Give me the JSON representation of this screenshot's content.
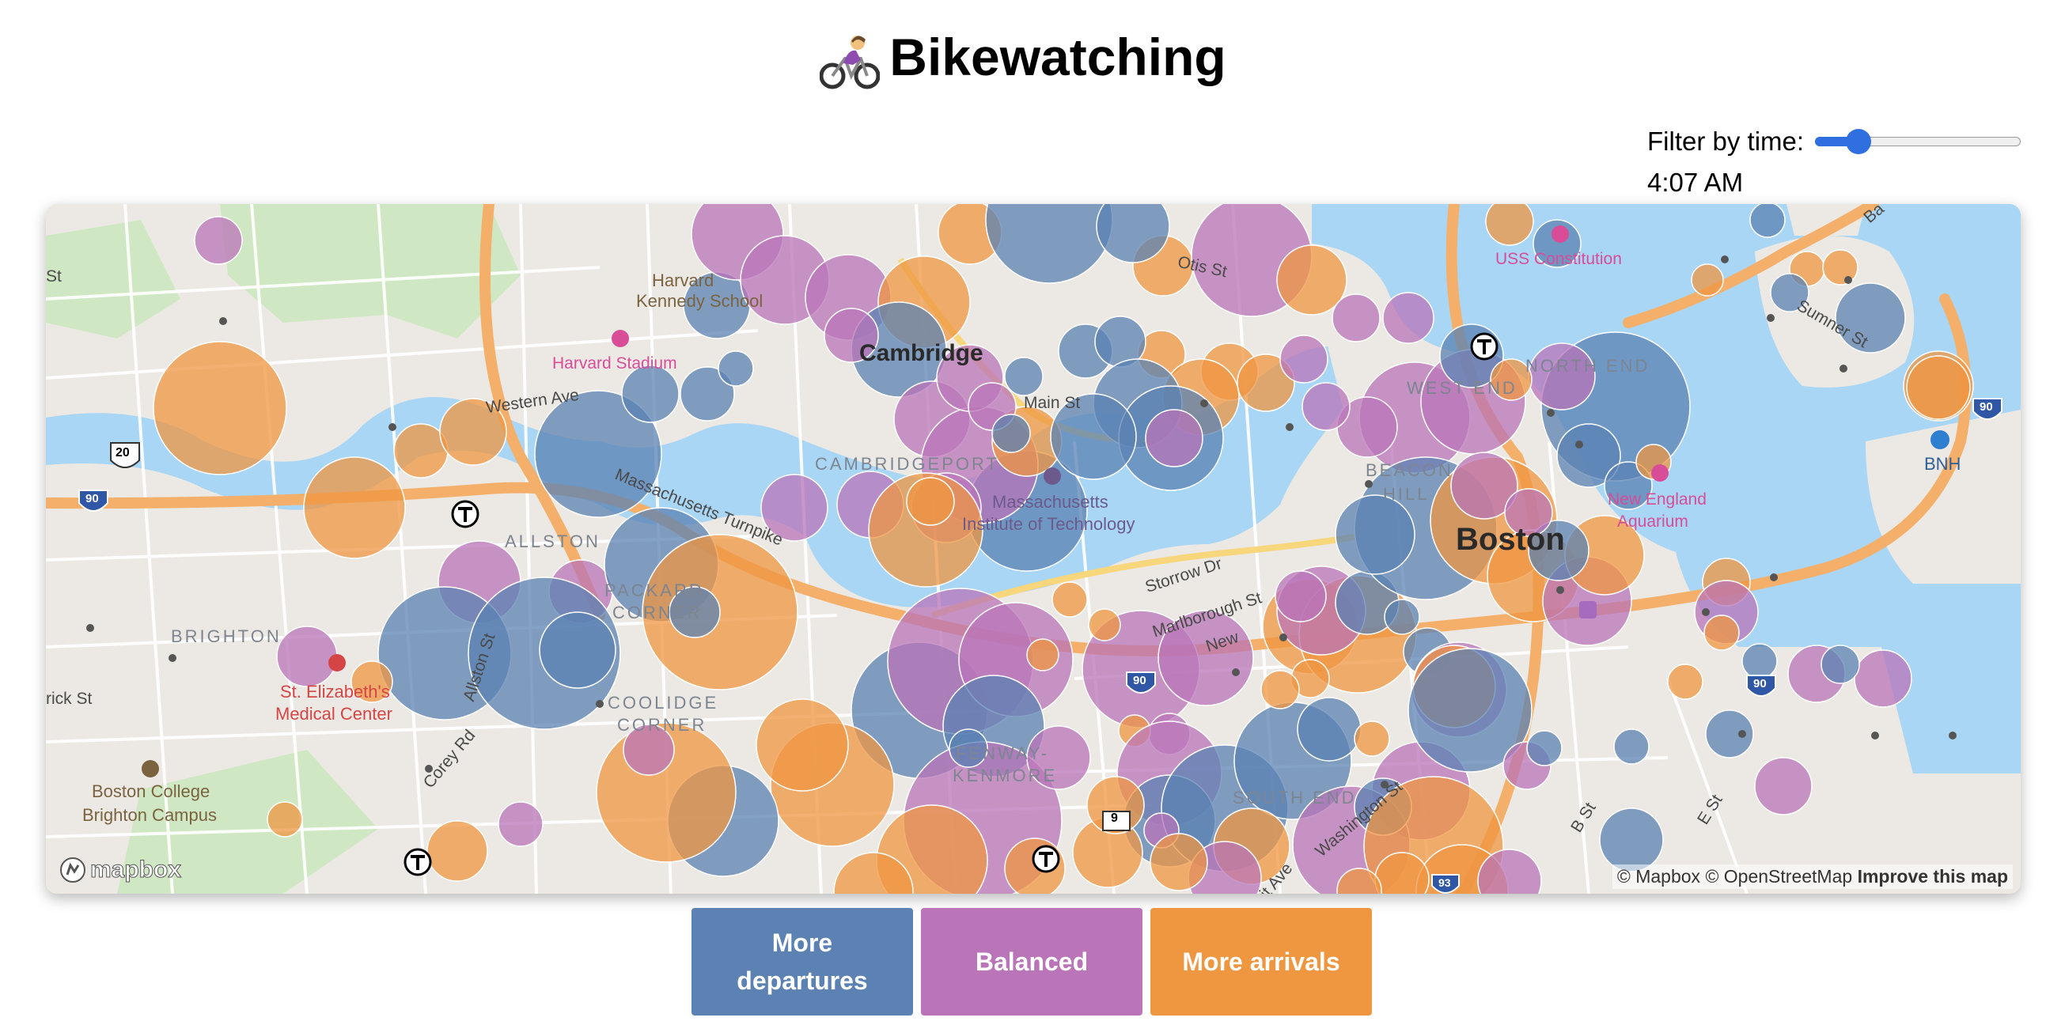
{
  "page": {
    "title": "Bikewatching",
    "title_icon": "woman-biking-icon"
  },
  "filter": {
    "label": "Filter by time:",
    "slider_value_fraction": 0.21,
    "time_display": "4:07 AM"
  },
  "map": {
    "labels": {
      "cambridge": "Cambridge",
      "boston": "Boston",
      "allston": "ALLSTON",
      "brighton": "BRIGHTON",
      "cambridgeport": "CAMBRIDGEPORT",
      "fenway": "FENWAY-",
      "kenmore": "KENMORE",
      "north_end": "NORTH END",
      "west_end": "WEST END",
      "beacon": "BEACON",
      "hill": "HILL",
      "packard": "PACKARD",
      "corner": "CORNER",
      "coolidge": "COOLIDGE",
      "coolidge_corner": "CORNER",
      "south_end": "SOUTH END",
      "western_ave": "Western Ave",
      "mass_pike": "Massachusetts Turnpike",
      "main_st": "Main St",
      "storrow": "Storrow Dr",
      "marlborough": "Marlborough St",
      "allston_st": "Allston St",
      "corey_rd": "Corey Rd",
      "otis_st": "Otis St",
      "sumner_st": "Sumner St",
      "b_st": "B St",
      "e_st": "E St",
      "washington_st": "Washington St",
      "new": "New",
      "st_left": "St",
      "rick_st": "rick St",
      "ave": "it Ave",
      "harvard": "Harvard",
      "kennedy": "Kennedy School",
      "harvard_stadium": "Harvard Stadium",
      "mit1": "Massachusetts",
      "mit2": "Institute of Technology",
      "st_elizabeth1": "St. Elizabeth's",
      "st_elizabeth2": "Medical Center",
      "bc1": "Boston College",
      "bc2": "Brighton Campus",
      "uss": "USS Constitution",
      "ne_aquarium1": "New England",
      "ne_aquarium2": "Aquarium",
      "bnh": "BNH",
      "hwy20": "20",
      "hwy90a": "90",
      "hwy90b": "90",
      "hwy90c": "90",
      "hwy90d": "90",
      "hwy93": "93",
      "route9": "9",
      "ba": "Ba"
    },
    "logo": "mapbox",
    "attribution": {
      "mapbox": "© Mapbox",
      "osm": "© OpenStreetMap",
      "improve": "Improve this map"
    }
  },
  "legend": {
    "departures": {
      "label": "More departures",
      "color": "#5b82b3"
    },
    "balanced": {
      "label": "Balanced",
      "color": "#ba74b8"
    },
    "arrivals": {
      "label": "More arrivals",
      "color": "#ef9641"
    }
  },
  "colors": {
    "water": "#a9d6f5",
    "park": "#cfe8c3",
    "highway": "#f4b06a",
    "land": "#ece9e4"
  }
}
